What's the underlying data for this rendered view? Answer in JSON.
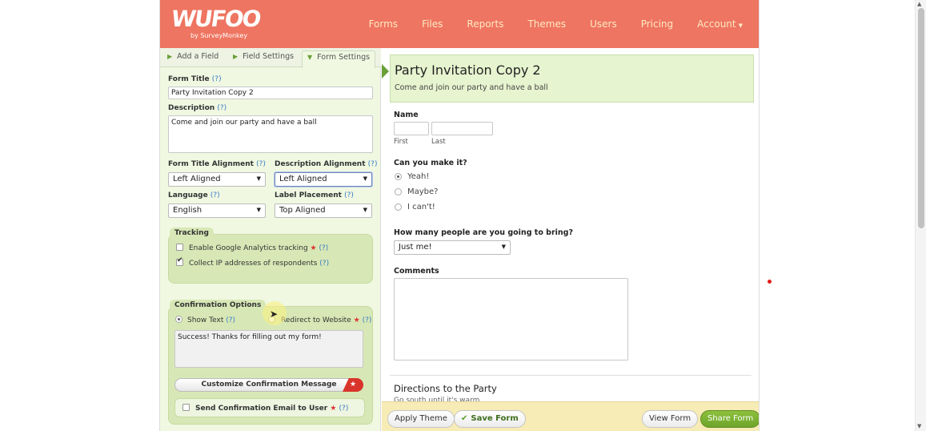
{
  "brand": {
    "logo": "WUFOO",
    "sub": "by SurveyMonkey"
  },
  "nav": {
    "forms": "Forms",
    "files": "Files",
    "reports": "Reports",
    "themes": "Themes",
    "users": "Users",
    "pricing": "Pricing",
    "account": "Account"
  },
  "tabs": {
    "add_field": "Add a Field",
    "field_settings": "Field Settings",
    "form_settings": "Form Settings"
  },
  "settings": {
    "help": "(?)",
    "form_title_label": "Form Title",
    "form_title_value": "Party Invitation Copy 2",
    "description_label": "Description",
    "description_value": "Come and join our party and have a ball",
    "title_align_label": "Form Title Alignment",
    "title_align_value": "Left Aligned",
    "desc_align_label": "Description Alignment",
    "desc_align_value": "Left Aligned",
    "language_label": "Language",
    "language_value": "English",
    "label_placement_label": "Label Placement",
    "label_placement_value": "Top Aligned"
  },
  "tracking": {
    "title": "Tracking",
    "ga": "Enable Google Analytics tracking",
    "ip": "Collect IP addresses of respondents"
  },
  "confirmation": {
    "title": "Confirmation Options",
    "show_text": "Show Text",
    "redirect": "Redirect to Website",
    "message": "Success! Thanks for filling out my form!",
    "customize": "Customize Confirmation Message",
    "send_email": "Send Confirmation Email to User"
  },
  "preview": {
    "title": "Party Invitation Copy 2",
    "description": "Come and join our party and have a ball",
    "name_label": "Name",
    "first": "First",
    "last": "Last",
    "q1": "Can you make it?",
    "q1_options": [
      "Yeah!",
      "Maybe?",
      "I can't!"
    ],
    "q2": "How many people are you going to bring?",
    "q2_value": "Just me!",
    "comments": "Comments",
    "section_title": "Directions to the Party",
    "section_text": "Go south until it's warm"
  },
  "footer": {
    "apply_theme": "Apply Theme",
    "save_form": "Save Form",
    "view_form": "View Form",
    "share_form": "Share Form"
  },
  "colors": {
    "header": "#ee7561",
    "accent_green": "#6aa038",
    "panel_green": "#d7e8b6",
    "footer_yellow": "#f7ebb6"
  }
}
